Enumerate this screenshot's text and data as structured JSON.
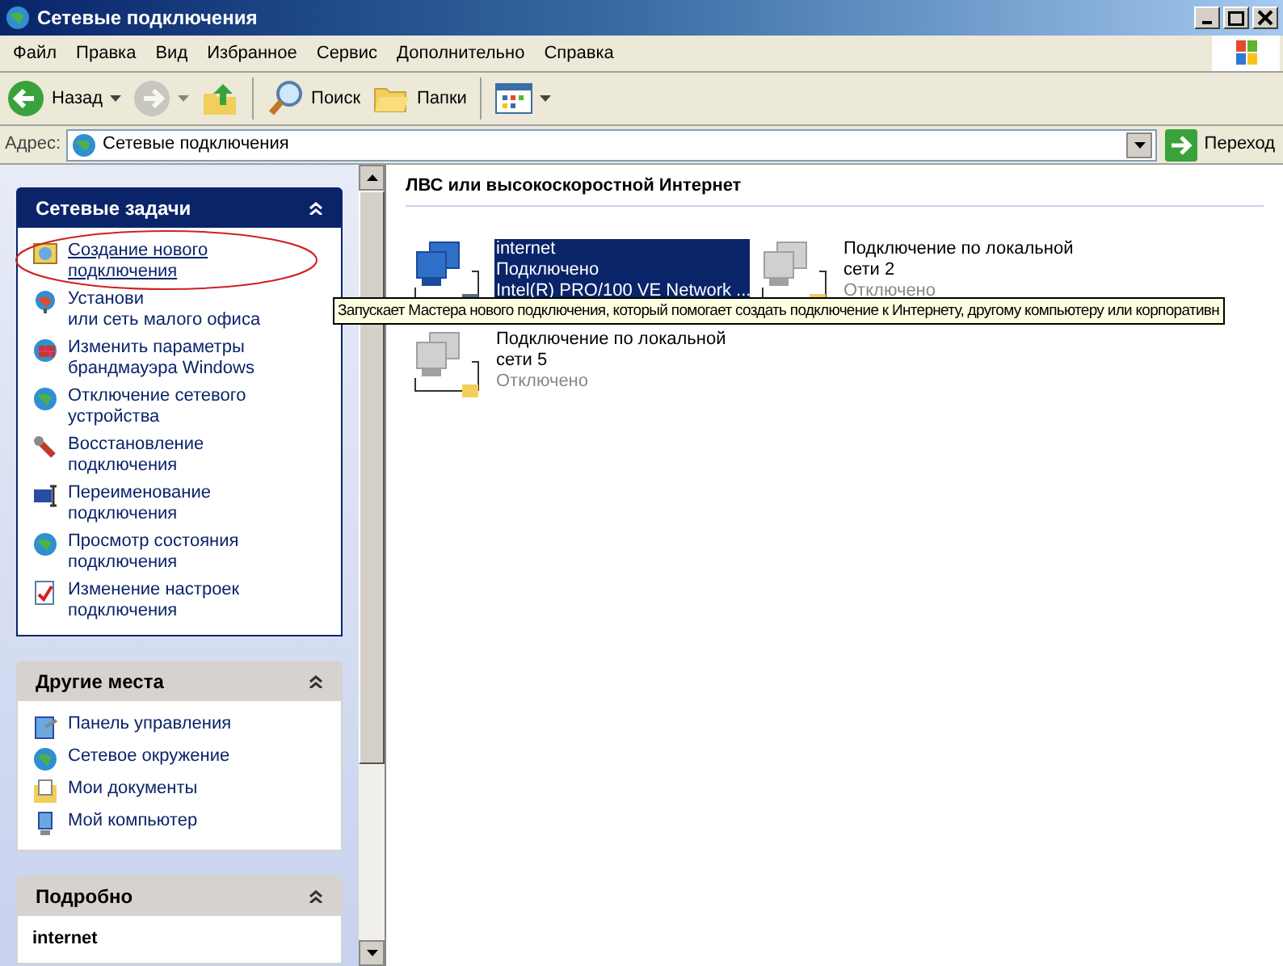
{
  "window": {
    "title": "Сетевые подключения"
  },
  "menu": [
    "Файл",
    "Правка",
    "Вид",
    "Избранное",
    "Сервис",
    "Дополнительно",
    "Справка"
  ],
  "toolbar": [
    {
      "kind": "back",
      "label": "Назад",
      "disabled": false
    },
    {
      "kind": "forward",
      "disabled": true
    },
    {
      "kind": "up",
      "disabled": false
    },
    {
      "kind": "search",
      "label": "Поиск",
      "disabled": false
    },
    {
      "kind": "folders",
      "label": "Папки",
      "disabled": false
    },
    {
      "kind": "views",
      "disabled": false
    }
  ],
  "address": {
    "label": "Адрес:",
    "value": "Сетевые подключения",
    "go": "Переход"
  },
  "sidebar": {
    "panels": [
      {
        "title": "Сетевые задачи",
        "kind": "special",
        "items": [
          {
            "lines": [
              "Создание нового",
              "подключения"
            ],
            "hovered": true
          },
          {
            "lines": [
              "Установи",
              "или сеть малого офиса"
            ],
            "hovered": false
          },
          {
            "lines": [
              "Изменить параметры",
              "брандмауэра Windows"
            ],
            "hovered": false
          },
          {
            "lines": [
              "Отключение сетевого",
              "устройства"
            ],
            "hovered": false
          },
          {
            "lines": [
              "Восстановление",
              "подключения"
            ],
            "hovered": false
          },
          {
            "lines": [
              "Переименование",
              "подключения"
            ],
            "hovered": false
          },
          {
            "lines": [
              "Просмотр состояния",
              "подключения"
            ],
            "hovered": false
          },
          {
            "lines": [
              "Изменение настроек",
              "подключения"
            ],
            "hovered": false
          }
        ]
      },
      {
        "title": "Другие места",
        "kind": "normal",
        "items": [
          {
            "lines": [
              "Панель управления"
            ],
            "hovered": false
          },
          {
            "lines": [
              "Сетевое окружение"
            ],
            "hovered": false
          },
          {
            "lines": [
              "Мои документы"
            ],
            "hovered": false
          },
          {
            "lines": [
              "Мой компьютер"
            ],
            "hovered": false
          }
        ]
      },
      {
        "title": "Подробно",
        "kind": "normal",
        "items": [
          {
            "lines": [
              "internet"
            ],
            "hovered": false
          }
        ]
      }
    ]
  },
  "group": {
    "title": "ЛВС или высокоскоростной Интернет"
  },
  "connections": [
    {
      "lines": [
        "internet"
      ],
      "status": "Подключено",
      "device": "Intel(R) PRO/100 VE Network ...",
      "connected": true,
      "selected": true
    },
    {
      "lines": [
        "Подключение по локальной",
        "сети 2"
      ],
      "status": "Отключено",
      "connected": false,
      "selected": false
    },
    {
      "lines": [
        "Подключение по локальной",
        "сети 5"
      ],
      "status": "Отключено",
      "connected": false,
      "selected": false
    }
  ],
  "tooltip": {
    "text": "Запускает Мастера нового подключения, который помогает создать подключение к Интернету, другому компьютеру или корпоративн"
  }
}
